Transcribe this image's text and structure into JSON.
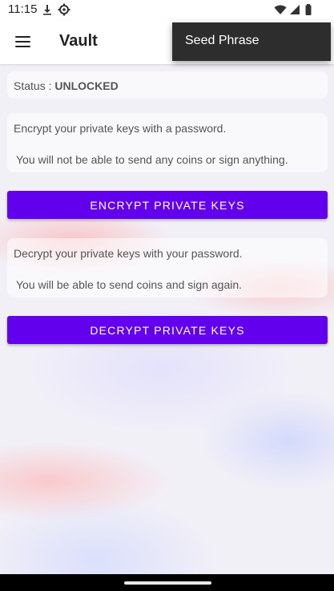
{
  "status_bar": {
    "time": "11:15"
  },
  "app_bar": {
    "title": "Vault"
  },
  "overflow_menu": {
    "items": [
      "Seed Phrase"
    ]
  },
  "status_card": {
    "label": "Status : ",
    "value": "UNLOCKED"
  },
  "encrypt_card": {
    "line1": "Encrypt your private keys with a password.",
    "line2": "You will not be able to send any coins or sign anything."
  },
  "encrypt_button": {
    "label": "ENCRYPT PRIVATE KEYS"
  },
  "decrypt_card": {
    "line1": "Decrypt your private keys with your password.",
    "line2": "You will be able to send coins and sign again."
  },
  "decrypt_button": {
    "label": "DECRYPT PRIVATE KEYS"
  },
  "colors": {
    "accent": "#6200ee",
    "menu_bg": "#2d2d2d"
  },
  "icons": [
    "download-icon",
    "settings-icon",
    "wifi-icon",
    "signal-icon",
    "battery-icon",
    "menu-icon"
  ]
}
